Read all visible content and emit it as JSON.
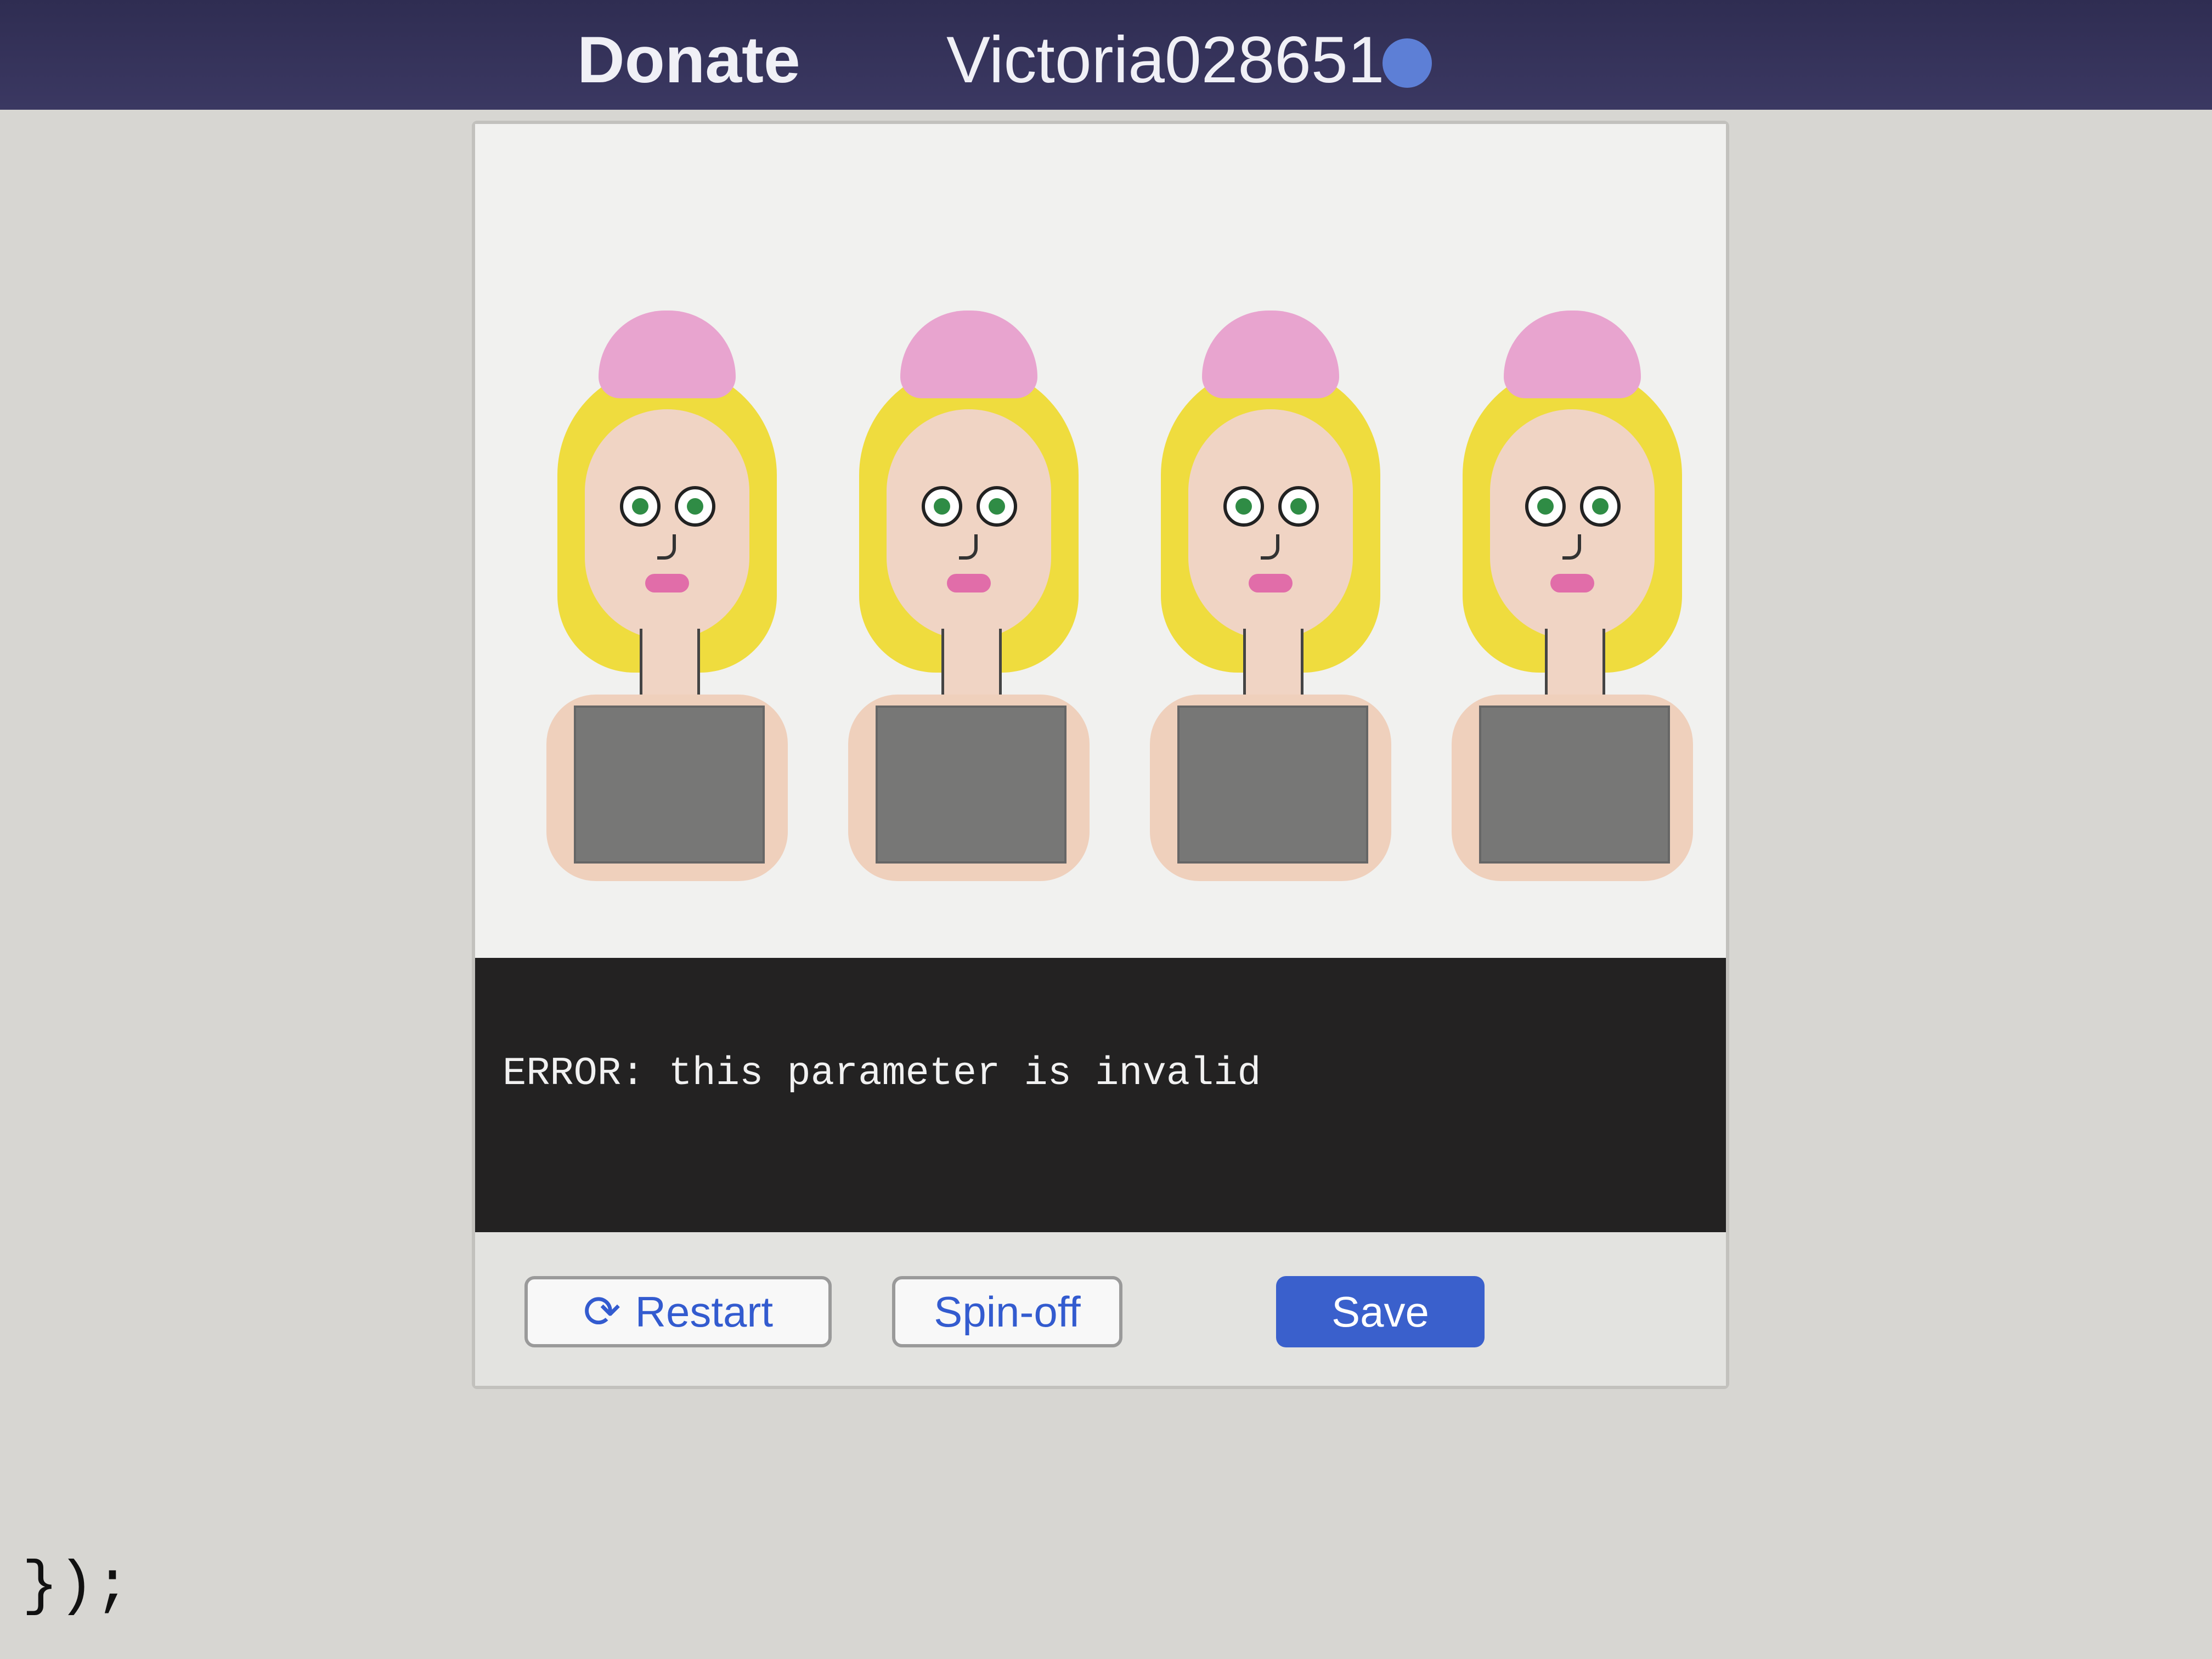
{
  "topbar": {
    "donate_label": "Donate",
    "username": "Victoria028651"
  },
  "code_fragment": "});",
  "stage": {
    "figures": [
      {
        "name": "figure-1"
      },
      {
        "name": "figure-2"
      },
      {
        "name": "figure-3"
      },
      {
        "name": "figure-4"
      }
    ]
  },
  "console": {
    "message": "ERROR: this parameter is invalid"
  },
  "actions": {
    "restart_label": "Restart",
    "spinoff_label": "Spin-off",
    "save_label": "Save"
  },
  "colors": {
    "topbar": "#2f2d52",
    "primary": "#3a60cc",
    "hair": "#efdc3e",
    "bun": "#e8a4cf",
    "skin": "#f0d4c4",
    "shirt": "#777776",
    "console_bg": "#232222"
  }
}
